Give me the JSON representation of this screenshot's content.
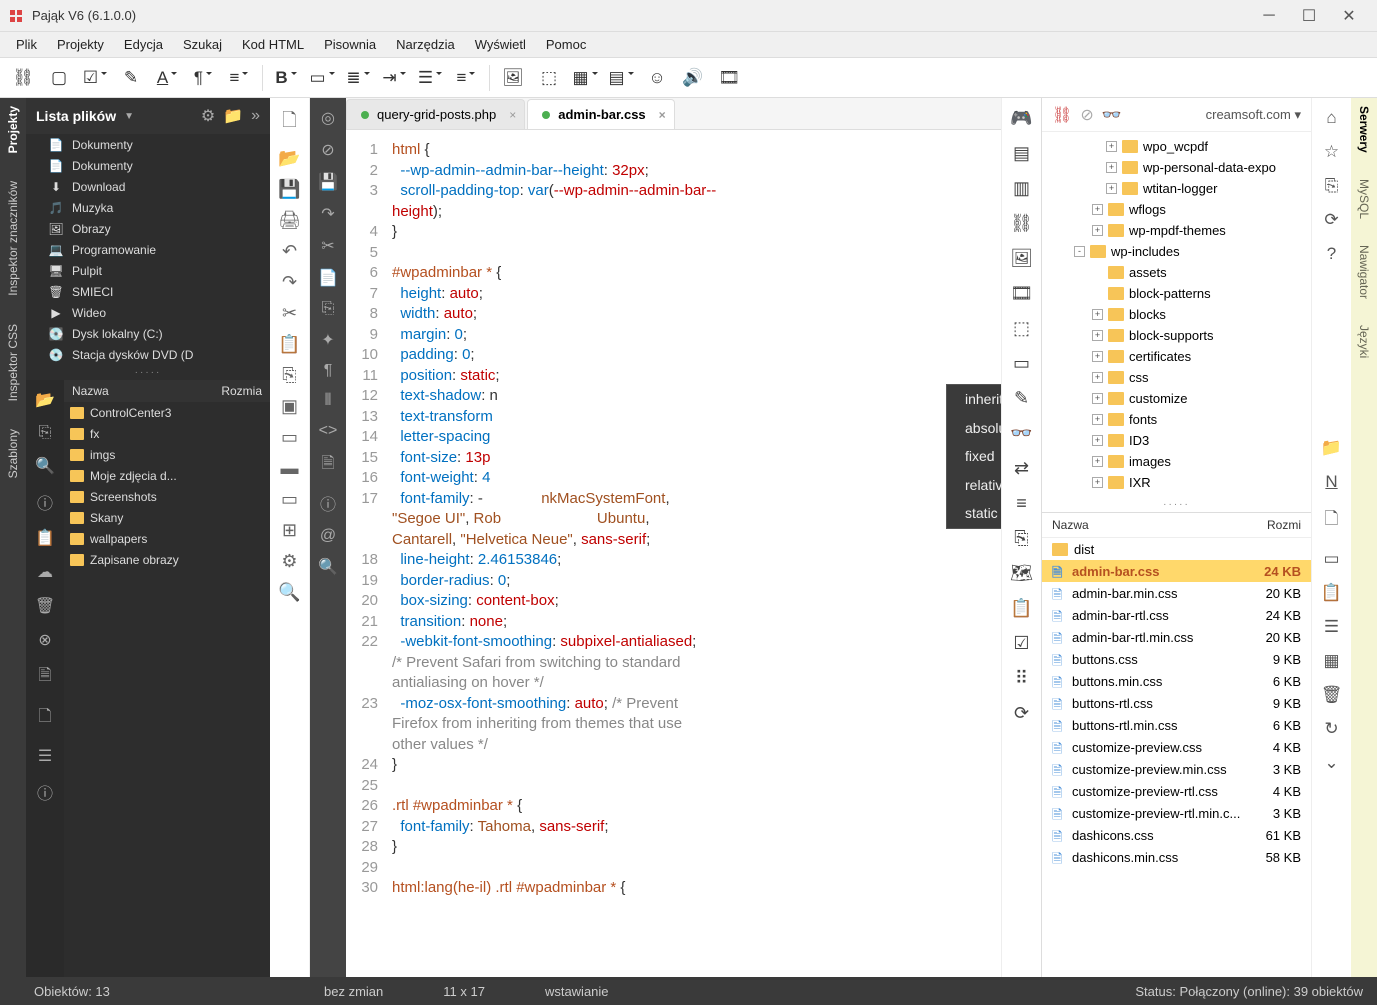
{
  "title": "Pająk V6 (6.1.0.0)",
  "menus": [
    "Plik",
    "Projekty",
    "Edycja",
    "Szukaj",
    "Kod HTML",
    "Pisownia",
    "Narzędzia",
    "Wyświetl",
    "Pomoc"
  ],
  "menus_underline": [
    "P",
    "P",
    "E",
    "S",
    "H",
    "P",
    "N",
    "W",
    "P"
  ],
  "left_vtabs": [
    "Projekty",
    "Inspektor znaczników",
    "Inspektor CSS",
    "Szablony"
  ],
  "right_vtabs": [
    "Serwery",
    "MySQL",
    "Nawigator",
    "Języki"
  ],
  "lp_title": "Lista plików",
  "lp_files": [
    {
      "icon": "doc",
      "label": "Dokumenty"
    },
    {
      "icon": "doc",
      "label": "Dokumenty"
    },
    {
      "icon": "dl",
      "label": "Download"
    },
    {
      "icon": "music",
      "label": "Muzyka"
    },
    {
      "icon": "img",
      "label": "Obrazy"
    },
    {
      "icon": "code",
      "label": "Programowanie"
    },
    {
      "icon": "desk",
      "label": "Pulpit"
    },
    {
      "icon": "trash",
      "label": "SMIECI"
    },
    {
      "icon": "vid",
      "label": "Wideo"
    },
    {
      "icon": "disk",
      "label": "Dysk lokalny (C:)"
    },
    {
      "icon": "dvd",
      "label": "Stacja dysków DVD (D"
    }
  ],
  "lp_hdr": {
    "c1": "Nazwa",
    "c2": "Rozmia"
  },
  "lp_folders": [
    "ControlCenter3",
    "fx",
    "imgs",
    "Moje zdjęcia d...",
    "Screenshots",
    "Skany",
    "wallpapers",
    "Zapisane obrazy"
  ],
  "lp_status": "Obiektów: 13",
  "tabs": [
    {
      "label": "query-grid-posts.php",
      "active": false
    },
    {
      "label": "admin-bar.css",
      "active": true
    }
  ],
  "code_lines": [
    {
      "n": 1,
      "seg": [
        {
          "t": "html ",
          "c": "sel"
        },
        {
          "t": "{",
          "c": "punc"
        }
      ]
    },
    {
      "n": 2,
      "seg": [
        {
          "t": "  ",
          "c": ""
        },
        {
          "t": "--wp-admin--admin-bar--height",
          "c": "prop"
        },
        {
          "t": ": ",
          "c": "punc"
        },
        {
          "t": "32px",
          "c": "val"
        },
        {
          "t": ";",
          "c": "punc"
        }
      ]
    },
    {
      "n": 3,
      "seg": [
        {
          "t": "  ",
          "c": ""
        },
        {
          "t": "scroll-padding-top",
          "c": "prop"
        },
        {
          "t": ": ",
          "c": "punc"
        },
        {
          "t": "var",
          "c": "func"
        },
        {
          "t": "(",
          "c": "punc"
        },
        {
          "t": "--wp-admin--admin-bar--",
          "c": "val"
        }
      ]
    },
    {
      "n": 0,
      "seg": [
        {
          "t": "height",
          "c": "val"
        },
        {
          "t": ");",
          "c": "punc"
        }
      ]
    },
    {
      "n": 4,
      "seg": [
        {
          "t": "}",
          "c": "punc"
        }
      ]
    },
    {
      "n": 5,
      "seg": [
        {
          "t": "",
          "c": ""
        }
      ]
    },
    {
      "n": 6,
      "seg": [
        {
          "t": "#wpadminbar * ",
          "c": "sel"
        },
        {
          "t": "{",
          "c": "punc"
        }
      ]
    },
    {
      "n": 7,
      "seg": [
        {
          "t": "  ",
          "c": ""
        },
        {
          "t": "height",
          "c": "prop"
        },
        {
          "t": ": ",
          "c": "punc"
        },
        {
          "t": "auto",
          "c": "val"
        },
        {
          "t": ";",
          "c": "punc"
        }
      ]
    },
    {
      "n": 8,
      "seg": [
        {
          "t": "  ",
          "c": ""
        },
        {
          "t": "width",
          "c": "prop"
        },
        {
          "t": ": ",
          "c": "punc"
        },
        {
          "t": "auto",
          "c": "val"
        },
        {
          "t": ";",
          "c": "punc"
        }
      ]
    },
    {
      "n": 9,
      "seg": [
        {
          "t": "  ",
          "c": ""
        },
        {
          "t": "margin",
          "c": "prop"
        },
        {
          "t": ": ",
          "c": "punc"
        },
        {
          "t": "0",
          "c": "num"
        },
        {
          "t": ";",
          "c": "punc"
        }
      ]
    },
    {
      "n": 10,
      "seg": [
        {
          "t": "  ",
          "c": ""
        },
        {
          "t": "padding",
          "c": "prop"
        },
        {
          "t": ": ",
          "c": "punc"
        },
        {
          "t": "0",
          "c": "num"
        },
        {
          "t": ";",
          "c": "punc"
        }
      ]
    },
    {
      "n": 11,
      "seg": [
        {
          "t": "  ",
          "c": ""
        },
        {
          "t": "position",
          "c": "prop"
        },
        {
          "t": ": ",
          "c": "punc"
        },
        {
          "t": "static",
          "c": "val"
        },
        {
          "t": ";",
          "c": "punc"
        }
      ]
    },
    {
      "n": 12,
      "seg": [
        {
          "t": "  ",
          "c": ""
        },
        {
          "t": "text-shadow",
          "c": "prop"
        },
        {
          "t": ": n",
          "c": "punc"
        }
      ]
    },
    {
      "n": 13,
      "seg": [
        {
          "t": "  ",
          "c": ""
        },
        {
          "t": "text-transform",
          "c": "prop"
        }
      ]
    },
    {
      "n": 14,
      "seg": [
        {
          "t": "  ",
          "c": ""
        },
        {
          "t": "letter-spacing",
          "c": "prop"
        }
      ]
    },
    {
      "n": 15,
      "seg": [
        {
          "t": "  ",
          "c": ""
        },
        {
          "t": "font-size",
          "c": "prop"
        },
        {
          "t": ": ",
          "c": "punc"
        },
        {
          "t": "13p",
          "c": "val"
        }
      ]
    },
    {
      "n": 16,
      "seg": [
        {
          "t": "  ",
          "c": ""
        },
        {
          "t": "font-weight",
          "c": "prop"
        },
        {
          "t": ": ",
          "c": "punc"
        },
        {
          "t": "4",
          "c": "num"
        }
      ]
    },
    {
      "n": 17,
      "seg": [
        {
          "t": "  ",
          "c": ""
        },
        {
          "t": "font-family",
          "c": "prop"
        },
        {
          "t": ": -",
          "c": "punc"
        },
        {
          "t": "              nkMacSystemFont",
          "c": "str"
        },
        {
          "t": ",",
          "c": "punc"
        }
      ]
    },
    {
      "n": 0,
      "seg": [
        {
          "t": "\"Segoe UI\"",
          "c": "str"
        },
        {
          "t": ", ",
          "c": "punc"
        },
        {
          "t": "Rob",
          "c": "str"
        },
        {
          "t": "                       Ubuntu",
          "c": "str"
        },
        {
          "t": ",",
          "c": "punc"
        }
      ]
    },
    {
      "n": 0,
      "seg": [
        {
          "t": "Cantarell",
          "c": "str"
        },
        {
          "t": ", ",
          "c": "punc"
        },
        {
          "t": "\"Helvetica Neue\"",
          "c": "str"
        },
        {
          "t": ", ",
          "c": "punc"
        },
        {
          "t": "sans-serif",
          "c": "val"
        },
        {
          "t": ";",
          "c": "punc"
        }
      ]
    },
    {
      "n": 18,
      "seg": [
        {
          "t": "  ",
          "c": ""
        },
        {
          "t": "line-height",
          "c": "prop"
        },
        {
          "t": ": ",
          "c": "punc"
        },
        {
          "t": "2.46153846",
          "c": "num"
        },
        {
          "t": ";",
          "c": "punc"
        }
      ]
    },
    {
      "n": 19,
      "seg": [
        {
          "t": "  ",
          "c": ""
        },
        {
          "t": "border-radius",
          "c": "prop"
        },
        {
          "t": ": ",
          "c": "punc"
        },
        {
          "t": "0",
          "c": "num"
        },
        {
          "t": ";",
          "c": "punc"
        }
      ]
    },
    {
      "n": 20,
      "seg": [
        {
          "t": "  ",
          "c": ""
        },
        {
          "t": "box-sizing",
          "c": "prop"
        },
        {
          "t": ": ",
          "c": "punc"
        },
        {
          "t": "content-box",
          "c": "val"
        },
        {
          "t": ";",
          "c": "punc"
        }
      ]
    },
    {
      "n": 21,
      "seg": [
        {
          "t": "  ",
          "c": ""
        },
        {
          "t": "transition",
          "c": "prop"
        },
        {
          "t": ": ",
          "c": "punc"
        },
        {
          "t": "none",
          "c": "val"
        },
        {
          "t": ";",
          "c": "punc"
        }
      ]
    },
    {
      "n": 22,
      "seg": [
        {
          "t": "  ",
          "c": ""
        },
        {
          "t": "-webkit-font-smoothing",
          "c": "prop"
        },
        {
          "t": ": ",
          "c": "punc"
        },
        {
          "t": "subpixel-antialiased",
          "c": "val"
        },
        {
          "t": ";",
          "c": "punc"
        }
      ]
    },
    {
      "n": 0,
      "seg": [
        {
          "t": "/* Prevent Safari from switching to standard",
          "c": "com"
        }
      ]
    },
    {
      "n": 0,
      "seg": [
        {
          "t": "antialiasing on hover */",
          "c": "com"
        }
      ]
    },
    {
      "n": 23,
      "seg": [
        {
          "t": "  ",
          "c": ""
        },
        {
          "t": "-moz-osx-font-smoothing",
          "c": "prop"
        },
        {
          "t": ": ",
          "c": "punc"
        },
        {
          "t": "auto",
          "c": "val"
        },
        {
          "t": "; ",
          "c": "punc"
        },
        {
          "t": "/* Prevent",
          "c": "com"
        }
      ]
    },
    {
      "n": 0,
      "seg": [
        {
          "t": "Firefox from inheriting from themes that use",
          "c": "com"
        }
      ]
    },
    {
      "n": 0,
      "seg": [
        {
          "t": "other values */",
          "c": "com"
        }
      ]
    },
    {
      "n": 24,
      "seg": [
        {
          "t": "}",
          "c": "punc"
        }
      ]
    },
    {
      "n": 25,
      "seg": [
        {
          "t": "",
          "c": ""
        }
      ]
    },
    {
      "n": 26,
      "seg": [
        {
          "t": ".rtl #wpadminbar * ",
          "c": "sel"
        },
        {
          "t": "{",
          "c": "punc"
        }
      ]
    },
    {
      "n": 27,
      "seg": [
        {
          "t": "  ",
          "c": ""
        },
        {
          "t": "font-family",
          "c": "prop"
        },
        {
          "t": ": ",
          "c": "punc"
        },
        {
          "t": "Tahoma",
          "c": "str"
        },
        {
          "t": ", ",
          "c": "punc"
        },
        {
          "t": "sans-serif",
          "c": "val"
        },
        {
          "t": ";",
          "c": "punc"
        }
      ]
    },
    {
      "n": 28,
      "seg": [
        {
          "t": "}",
          "c": "punc"
        }
      ]
    },
    {
      "n": 29,
      "seg": [
        {
          "t": "",
          "c": ""
        }
      ]
    },
    {
      "n": 30,
      "seg": [
        {
          "t": "html:lang(he-il) .rtl #wpadminbar * ",
          "c": "sel"
        },
        {
          "t": "{",
          "c": "punc"
        }
      ]
    }
  ],
  "autocomplete": [
    "inherit",
    "absolute",
    "fixed",
    "relative",
    "static"
  ],
  "rp_site": "creamsoft.com",
  "rp_tree": [
    {
      "l": 3,
      "exp": "+",
      "label": "wpo_wcpdf"
    },
    {
      "l": 3,
      "exp": "+",
      "label": "wp-personal-data-expo"
    },
    {
      "l": 3,
      "exp": "+",
      "label": "wtitan-logger"
    },
    {
      "l": 2,
      "exp": "+",
      "label": "wflogs"
    },
    {
      "l": 2,
      "exp": "+",
      "label": "wp-mpdf-themes"
    },
    {
      "l": 1,
      "exp": "-",
      "label": "wp-includes"
    },
    {
      "l": 2,
      "exp": "",
      "label": "assets"
    },
    {
      "l": 2,
      "exp": "",
      "label": "block-patterns"
    },
    {
      "l": 2,
      "exp": "+",
      "label": "blocks"
    },
    {
      "l": 2,
      "exp": "+",
      "label": "block-supports"
    },
    {
      "l": 2,
      "exp": "+",
      "label": "certificates"
    },
    {
      "l": 2,
      "exp": "+",
      "label": "css"
    },
    {
      "l": 2,
      "exp": "+",
      "label": "customize"
    },
    {
      "l": 2,
      "exp": "+",
      "label": "fonts"
    },
    {
      "l": 2,
      "exp": "+",
      "label": "ID3"
    },
    {
      "l": 2,
      "exp": "+",
      "label": "images"
    },
    {
      "l": 2,
      "exp": "+",
      "label": "IXR"
    }
  ],
  "rp_hdr": {
    "c1": "Nazwa",
    "c2": "Rozmi"
  },
  "rp_files": [
    {
      "type": "folder",
      "name": "dist",
      "size": ""
    },
    {
      "type": "file",
      "name": "admin-bar.css",
      "size": "24 KB",
      "sel": true
    },
    {
      "type": "file",
      "name": "admin-bar.min.css",
      "size": "20 KB"
    },
    {
      "type": "file",
      "name": "admin-bar-rtl.css",
      "size": "24 KB"
    },
    {
      "type": "file",
      "name": "admin-bar-rtl.min.css",
      "size": "20 KB"
    },
    {
      "type": "file",
      "name": "buttons.css",
      "size": "9 KB"
    },
    {
      "type": "file",
      "name": "buttons.min.css",
      "size": "6 KB"
    },
    {
      "type": "file",
      "name": "buttons-rtl.css",
      "size": "9 KB"
    },
    {
      "type": "file",
      "name": "buttons-rtl.min.css",
      "size": "6 KB"
    },
    {
      "type": "file",
      "name": "customize-preview.css",
      "size": "4 KB"
    },
    {
      "type": "file",
      "name": "customize-preview.min.css",
      "size": "3 KB"
    },
    {
      "type": "file",
      "name": "customize-preview-rtl.css",
      "size": "4 KB"
    },
    {
      "type": "file",
      "name": "customize-preview-rtl.min.c...",
      "size": "3 KB"
    },
    {
      "type": "file",
      "name": "dashicons.css",
      "size": "61 KB"
    },
    {
      "type": "file",
      "name": "dashicons.min.css",
      "size": "58 KB"
    }
  ],
  "status": {
    "left": "",
    "mid1": "bez zmian",
    "mid2": "11 x 17",
    "mid3": "wstawianie",
    "right": "Status: Połączony (online): 39 obiektów"
  }
}
